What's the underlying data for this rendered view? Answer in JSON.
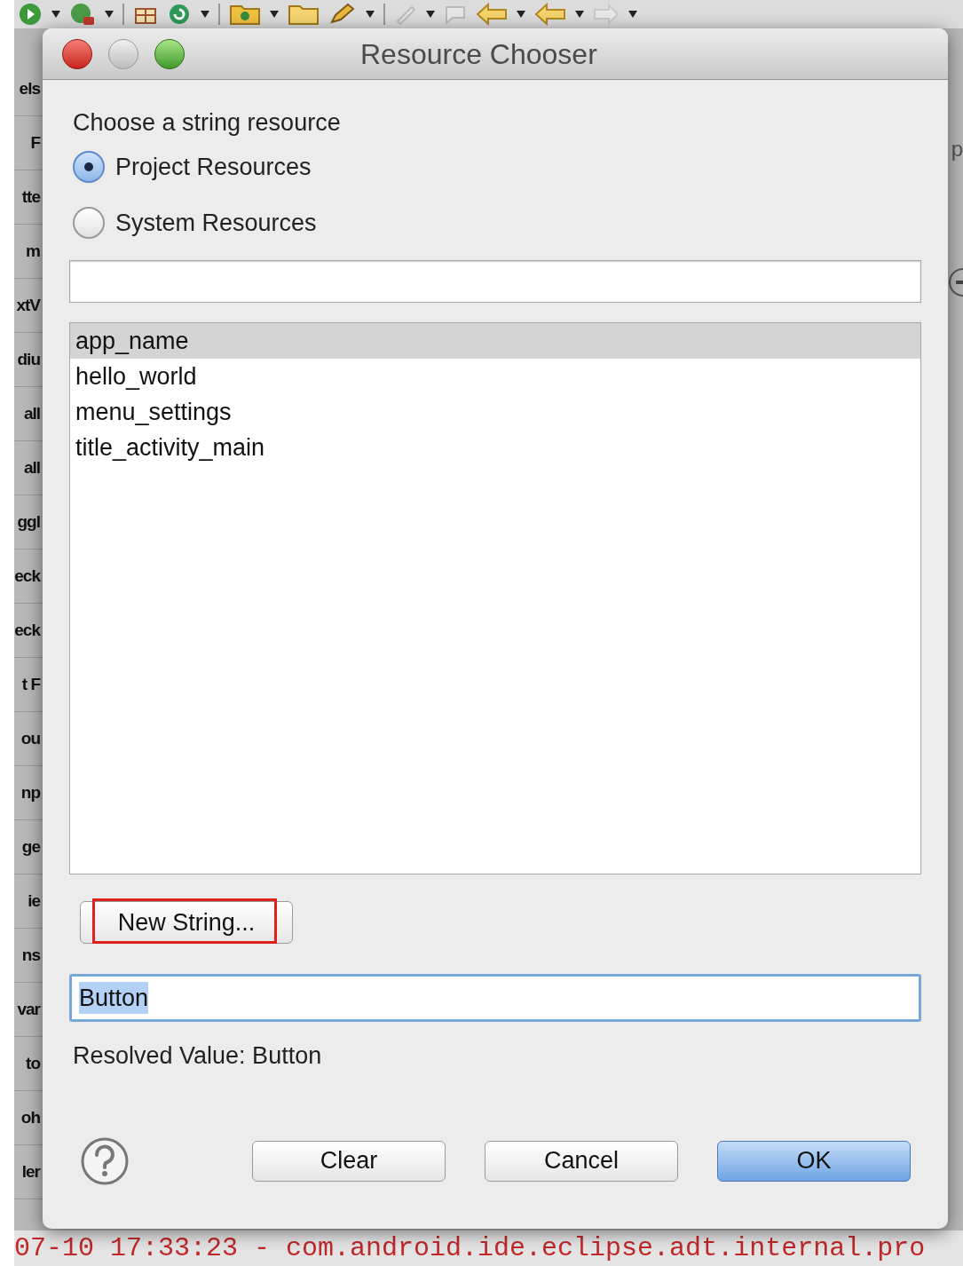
{
  "background": {
    "palette_fragments": [
      "els",
      "F",
      "tte",
      "m",
      "xtV",
      "diu",
      "all",
      "all",
      "ggl",
      "eck",
      "eck",
      "t F",
      "ou",
      "np",
      "ge",
      "ie",
      "ns",
      "var",
      "to",
      "oh",
      "ler"
    ],
    "right_fragments": [
      "p"
    ],
    "console_line": "07-10 17:33:23 - com.android.ide.eclipse.adt.internal.pro"
  },
  "dialog": {
    "title": "Resource Chooser",
    "prompt": "Choose a string resource",
    "sources": [
      {
        "label": "Project Resources",
        "selected": true
      },
      {
        "label": "System Resources",
        "selected": false
      }
    ],
    "resources": [
      {
        "name": "app_name",
        "selected": true
      },
      {
        "name": "hello_world",
        "selected": false
      },
      {
        "name": "menu_settings",
        "selected": false
      },
      {
        "name": "title_activity_main",
        "selected": false
      }
    ],
    "new_string_button": {
      "label": "New String...",
      "annotated": true
    },
    "value_field": {
      "value": "Button",
      "text_selected": true
    },
    "resolved": "Resolved Value: Button",
    "buttons": [
      {
        "label": "Clear",
        "default": false
      },
      {
        "label": "Cancel",
        "default": false
      },
      {
        "label": "OK",
        "default": true
      }
    ]
  }
}
